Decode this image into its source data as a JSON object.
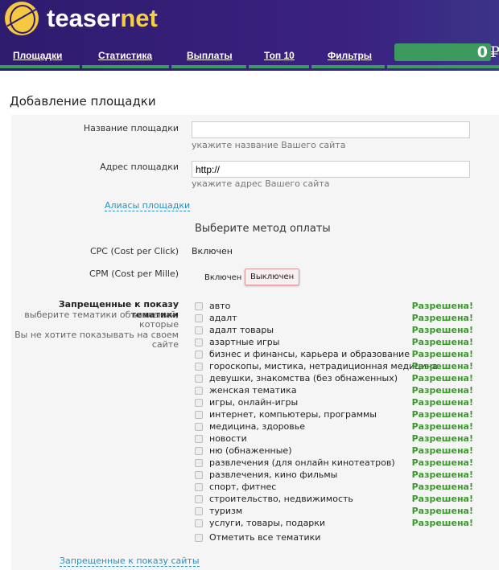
{
  "brand": {
    "part1": "teaser",
    "part2": "net"
  },
  "nav": [
    "Площадки",
    "Статистика",
    "Выплаты",
    "Топ 10",
    "Фильтры"
  ],
  "balance": {
    "amount": "0",
    "currency": "₽"
  },
  "page_title": "Добавление площадки",
  "form": {
    "site_name_label": "Название площадки",
    "site_name_value": "",
    "site_name_hint": "укажите название Вашего сайта",
    "site_url_label": "Адрес площадки",
    "site_url_value": "http://",
    "site_url_hint": "укажите адрес Вашего сайта",
    "aliases_link": "Алиасы площадки",
    "payment_heading": "Выберите метод оплаты",
    "cpc_label": "CPC (Cost per Click)",
    "cpc_value": "Включен",
    "cpm_label": "CPM (Cost per Mille)",
    "cpm_on": "Включен",
    "cpm_off": "Выключен",
    "topics_label": "Запрещенные к показу тематики",
    "topics_hint1": "выберите тематики объявлений,",
    "topics_hint2": "которые",
    "topics_hint3": "Вы не хотите показывать на своем",
    "topics_hint4": "сайте",
    "topics": [
      "авто",
      "адалт",
      "адалт товары",
      "азартные игры",
      "бизнес и финансы, карьера и образование",
      "гороскопы, мистика, нетрадиционная медицина",
      "девушки, знакомства (без обнаженных)",
      "женская тематика",
      "игры, онлайн-игры",
      "интернет, компьютеры, программы",
      "медицина, здоровье",
      "новости",
      "ню (обнаженные)",
      "развлечения (для онлайн кинотеатров)",
      "развлечения, кино фильмы",
      "спорт, фитнес",
      "строительство, недвижимость",
      "туризм",
      "услуги, товары, подарки"
    ],
    "topic_status": "Разрешена!",
    "select_all": "Отметить все тематики",
    "blocked_sites_link": "Запрещенные к показу сайты"
  }
}
